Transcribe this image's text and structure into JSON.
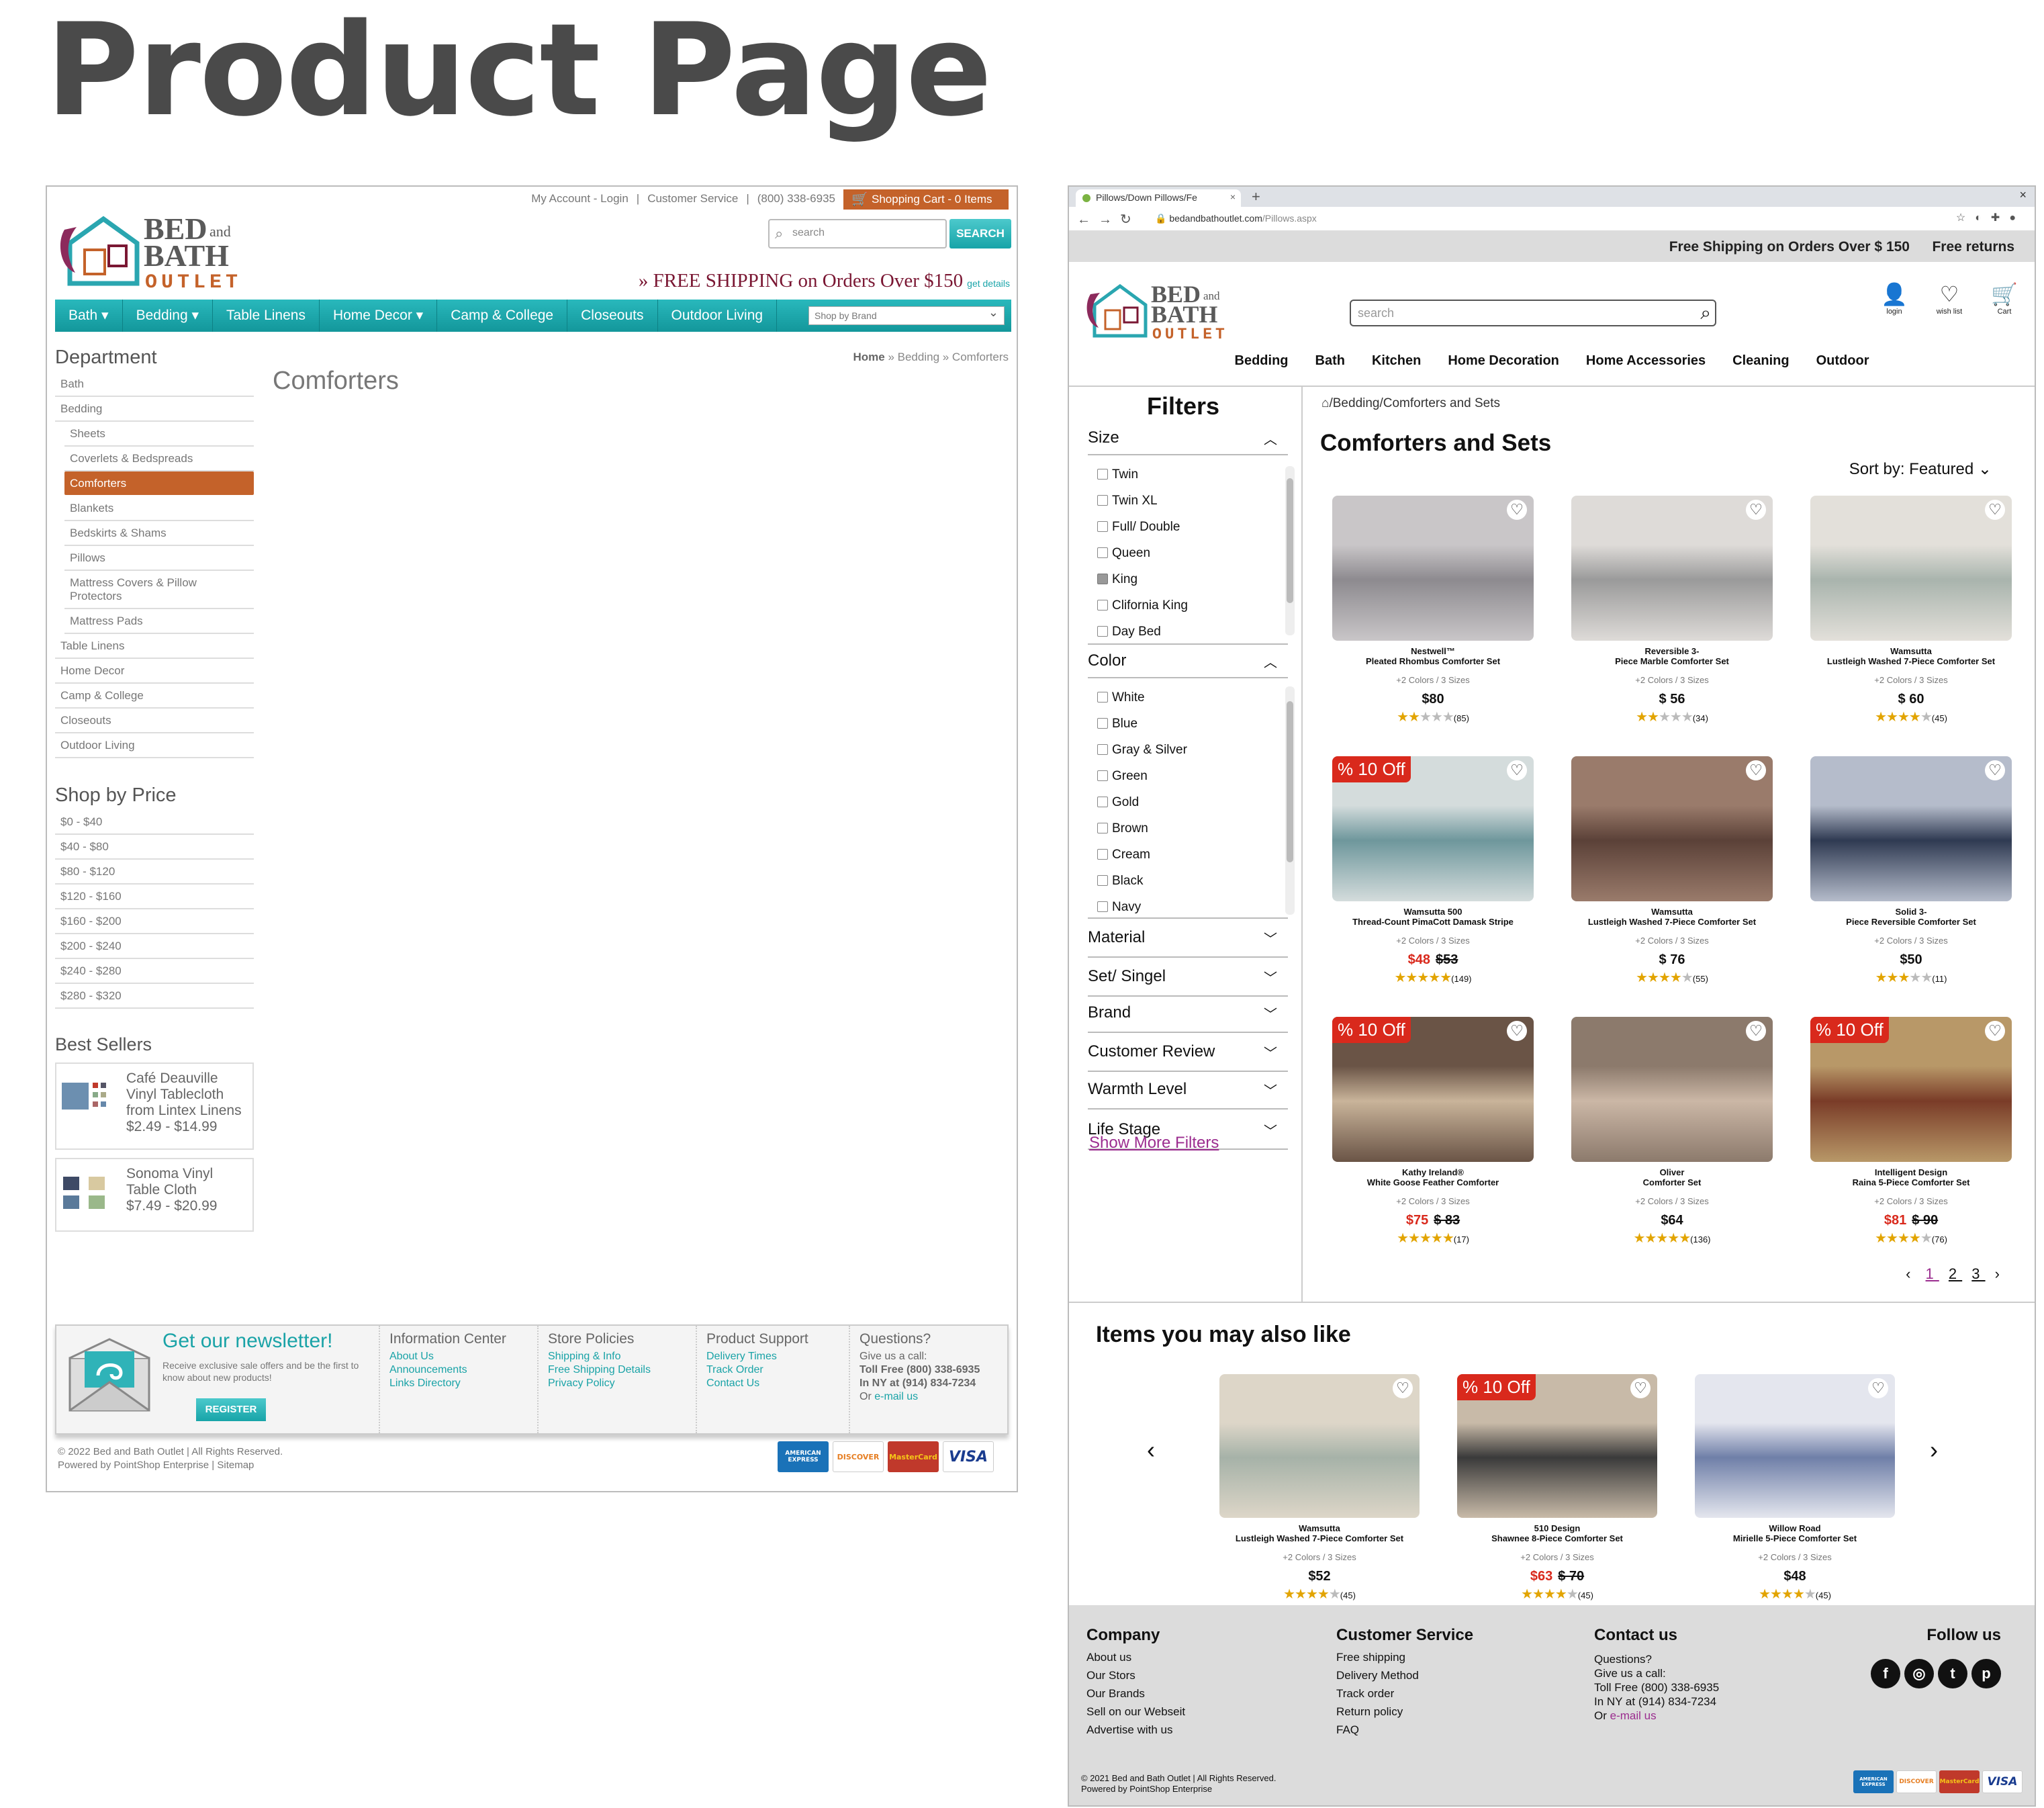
{
  "page_title": "Product Page",
  "old_site": {
    "top_links": [
      "My Account - Login",
      "|",
      "Customer Service",
      "|",
      "(800) 338-6935"
    ],
    "cart": "Shopping Cart - 0 Items",
    "search_placeholder": "search",
    "search_button": "SEARCH",
    "free_shipping": "» FREE SHIPPING on Orders Over $150",
    "get_details": "get details",
    "nav": [
      "Bath ▾",
      "Bedding ▾",
      "Table Linens",
      "Home Decor ▾",
      "Camp & College",
      "Closeouts",
      "Outdoor Living"
    ],
    "shop_by_brand": "Shop by Brand",
    "department_heading": "Department",
    "departments": [
      {
        "label": "Bath",
        "sub": false
      },
      {
        "label": "Bedding",
        "sub": false
      },
      {
        "label": "Sheets",
        "sub": true
      },
      {
        "label": "Coverlets & Bedspreads",
        "sub": true
      },
      {
        "label": "Comforters",
        "sub": true,
        "active": true
      },
      {
        "label": "Blankets",
        "sub": true
      },
      {
        "label": "Bedskirts & Shams",
        "sub": true
      },
      {
        "label": "Pillows",
        "sub": true
      },
      {
        "label": "Mattress Covers & Pillow Protectors",
        "sub": true
      },
      {
        "label": "Mattress Pads",
        "sub": true
      },
      {
        "label": "Table Linens",
        "sub": false
      },
      {
        "label": "Home Decor",
        "sub": false
      },
      {
        "label": "Camp & College",
        "sub": false
      },
      {
        "label": "Closeouts",
        "sub": false
      },
      {
        "label": "Outdoor Living",
        "sub": false
      }
    ],
    "price_heading": "Shop by Price",
    "prices": [
      "$0 - $40",
      "$40 - $80",
      "$80 - $120",
      "$120 - $160",
      "$160 - $200",
      "$200 - $240",
      "$240 - $280",
      "$280 - $320"
    ],
    "best_heading": "Best Sellers",
    "best_sellers": [
      {
        "name": "Café Deauville Vinyl Tablecloth from Lintex Linens",
        "price": "$2.49 - $14.99"
      },
      {
        "name": "Sonoma Vinyl Table Cloth",
        "price": "$7.49 - $20.99"
      }
    ],
    "breadcrumb_home": "Home",
    "breadcrumb_rest": " » Bedding » Comforters",
    "category_title": "Comforters",
    "newsletter_title": "Get our newsletter!",
    "newsletter_text": "Receive exclusive sale offers and be the first to know about new products!",
    "register": "REGISTER",
    "footer_cols": [
      {
        "title": "Information Center",
        "links": [
          "About Us",
          "Announcements",
          "Links Directory"
        ]
      },
      {
        "title": "Store Policies",
        "links": [
          "Shipping & Info",
          "Free Shipping Details",
          "Privacy Policy"
        ]
      },
      {
        "title": "Product Support",
        "links": [
          "Delivery Times",
          "Track Order",
          "Contact Us"
        ]
      }
    ],
    "questions_title": "Questions?",
    "questions_lines": [
      "Give us a call:",
      "Toll Free (800) 338-6935",
      "In NY at (914) 834-7234"
    ],
    "questions_email_prefix": "Or ",
    "questions_email": "e-mail us",
    "copyright": "© 2022 Bed and Bath Outlet | All Rights Reserved.",
    "powered": "Powered by PointShop Enterprise | Sitemap"
  },
  "new_site": {
    "tab_title": "Pillows/Down Pillows/Fe",
    "url_host": "bedandbathoutlet.com",
    "url_path": "/Pillows.aspx",
    "strip_free_shipping": "Free Shipping on Orders Over $ 150",
    "strip_returns": "Free returns",
    "search_placeholder": "search",
    "icons": [
      {
        "icon": "user-icon",
        "label": "login"
      },
      {
        "icon": "heart-icon",
        "label": "wish list"
      },
      {
        "icon": "cart-icon",
        "label": "Cart"
      }
    ],
    "menu": [
      "Bedding",
      "Bath",
      "Kitchen",
      "Home Decoration",
      "Home Accessories",
      "Cleaning",
      "Outdoor"
    ],
    "filters_heading": "Filters",
    "size_heading": "Size",
    "sizes": [
      {
        "label": "Twin",
        "checked": false
      },
      {
        "label": "Twin XL",
        "checked": false
      },
      {
        "label": "Full/ Double",
        "checked": false
      },
      {
        "label": "Queen",
        "checked": false
      },
      {
        "label": "King",
        "checked": true
      },
      {
        "label": "Clifornia King",
        "checked": false
      },
      {
        "label": "Day Bed",
        "checked": false
      }
    ],
    "color_heading": "Color",
    "colors": [
      "White",
      "Blue",
      "Gray & Silver",
      "Green",
      "Gold",
      "Brown",
      "Cream",
      "Black",
      "Navy"
    ],
    "collapsed_filters": [
      "Material",
      "Set/ Singel",
      "Brand",
      "Customer Review",
      "Warmth Level",
      "Life Stage"
    ],
    "show_more": "Show More Filters",
    "breadcrumb": "/Bedding/Comforters and Sets",
    "heading": "Comforters and Sets",
    "sort": "Sort by: Featured ⌄",
    "products": [
      {
        "brand": "Nestwell™",
        "name": "Pleated Rhombus Comforter Set",
        "variants": "+2 Colors / 3 Sizes",
        "price": "$80",
        "old": "",
        "sale": false,
        "off": "",
        "stars": 2,
        "count": "(85)",
        "img": [
          "#8d8a8f",
          "#c9c6c8"
        ]
      },
      {
        "brand": "Reversible 3-",
        "name": "Piece Marble Comforter Set",
        "variants": "+2 Colors / 3 Sizes",
        "price": "$ 56",
        "old": "",
        "sale": false,
        "off": "",
        "stars": 2,
        "count": "(34)",
        "img": [
          "#9a9a9a",
          "#dedbd8"
        ]
      },
      {
        "brand": "Wamsutta",
        "name": "Lustleigh Washed 7-Piece Comforter Set",
        "variants": "+2 Colors / 3 Sizes",
        "price": "$ 60",
        "old": "",
        "sale": false,
        "off": "",
        "stars": 4,
        "count": "(45)",
        "img": [
          "#a9b4ad",
          "#e3e0da"
        ]
      },
      {
        "brand": "Wamsutta 500",
        "name": "Thread-Count PimaCott Damask Stripe",
        "variants": "+2 Colors / 3 Sizes",
        "price": "$48",
        "old": "$53",
        "sale": true,
        "off": "% 10 Off",
        "stars": 5,
        "count": "(149)",
        "img": [
          "#6e979c",
          "#d4dcdc"
        ]
      },
      {
        "brand": "Wamsutta",
        "name": "Lustleigh Washed 7-Piece Comforter Set",
        "variants": "+2 Colors / 3 Sizes",
        "price": "$ 76",
        "old": "",
        "sale": false,
        "off": "",
        "stars": 4,
        "count": "(55)",
        "img": [
          "#5b4138",
          "#9a7b6b"
        ]
      },
      {
        "brand": "Solid 3-",
        "name": "Piece Reversible Comforter Set",
        "variants": "+2 Colors / 3 Sizes",
        "price": "$50",
        "old": "",
        "sale": false,
        "off": "",
        "stars": 3,
        "count": "(11)",
        "img": [
          "#2f3a52",
          "#b5bccb"
        ]
      },
      {
        "brand": "Kathy Ireland®",
        "name": "White Goose Feather Comforter",
        "variants": "+2 Colors / 3 Sizes",
        "price": "$75",
        "old": "$ 83",
        "sale": true,
        "off": "% 10 Off",
        "stars": 5,
        "count": "(17)",
        "img": [
          "#c9b49a",
          "#6a5446"
        ]
      },
      {
        "brand": "Oliver",
        "name": "Comforter Set",
        "variants": "+2 Colors / 3 Sizes",
        "price": "$64",
        "old": "",
        "sale": false,
        "off": "",
        "stars": 5,
        "count": "(136)",
        "img": [
          "#cbb7a6",
          "#8c7a6c"
        ]
      },
      {
        "brand": "Intelligent Design",
        "name": "Raina 5-Piece Comforter Set",
        "variants": "+2 Colors / 3 Sizes",
        "price": "$81",
        "old": "$ 90",
        "sale": true,
        "off": "% 10 Off",
        "stars": 4,
        "count": "(76)",
        "img": [
          "#7a3c28",
          "#b89868"
        ]
      }
    ],
    "pager": {
      "prev": "‹",
      "pages": [
        "1",
        "2",
        "3"
      ],
      "next": "›"
    },
    "also_heading": "Items you may  also like",
    "also_products": [
      {
        "brand": "Wamsutta",
        "name": "Lustleigh Washed 7-Piece Comforter Set",
        "variants": "+2 Colors / 3 Sizes",
        "price": "$52",
        "old": "",
        "sale": false,
        "off": "",
        "stars": 4,
        "count": "(45)",
        "img": [
          "#a6b2a8",
          "#ddd6c8"
        ]
      },
      {
        "brand": "510 Design",
        "name": "Shawnee 8-Piece Comforter Set",
        "variants": "+2 Colors / 3 Sizes",
        "price": "$63",
        "old": "$ 70",
        "sale": true,
        "off": "% 10 Off",
        "stars": 4,
        "count": "(45)",
        "img": [
          "#3a3a3a",
          "#c8baa8"
        ]
      },
      {
        "brand": "Willow Road",
        "name": "Mirielle 5-Piece Comforter Set",
        "variants": "+2 Colors / 3 Sizes",
        "price": "$48",
        "old": "",
        "sale": false,
        "off": "",
        "stars": 4,
        "count": "(45)",
        "img": [
          "#6f7fa8",
          "#e4e6ee"
        ]
      }
    ],
    "footer": {
      "company_title": "Company",
      "company": [
        "About us",
        "Our Stors",
        "Our Brands",
        "Sell on our Webseit",
        "Advertise with us"
      ],
      "service_title": "Customer Service",
      "service": [
        "Free shipping",
        "Delivery Method",
        "Track order",
        "Return policy",
        "FAQ"
      ],
      "contact_title": "Contact us",
      "contact": [
        "Questions?",
        "Give us a call:",
        "Toll Free (800) 338-6935",
        "In NY at (914) 834-7234"
      ],
      "contact_email_prefix": "Or ",
      "contact_email": "e-mail us",
      "follow_title": "Follow us",
      "social": [
        "facebook-icon",
        "instagram-icon",
        "twitter-icon",
        "pinterest-icon"
      ],
      "copyright": "© 2021 Bed and Bath Outlet | All Rights Reserved.",
      "powered": "Powered by PointShop Enterprise"
    }
  },
  "logo": {
    "line1": "BED",
    "and": "and",
    "line2": "BATH",
    "line3": "OUTLET"
  },
  "payment_cards": [
    "AMERICAN EXPRESS",
    "DISCOVER",
    "MasterCard",
    "VISA"
  ]
}
